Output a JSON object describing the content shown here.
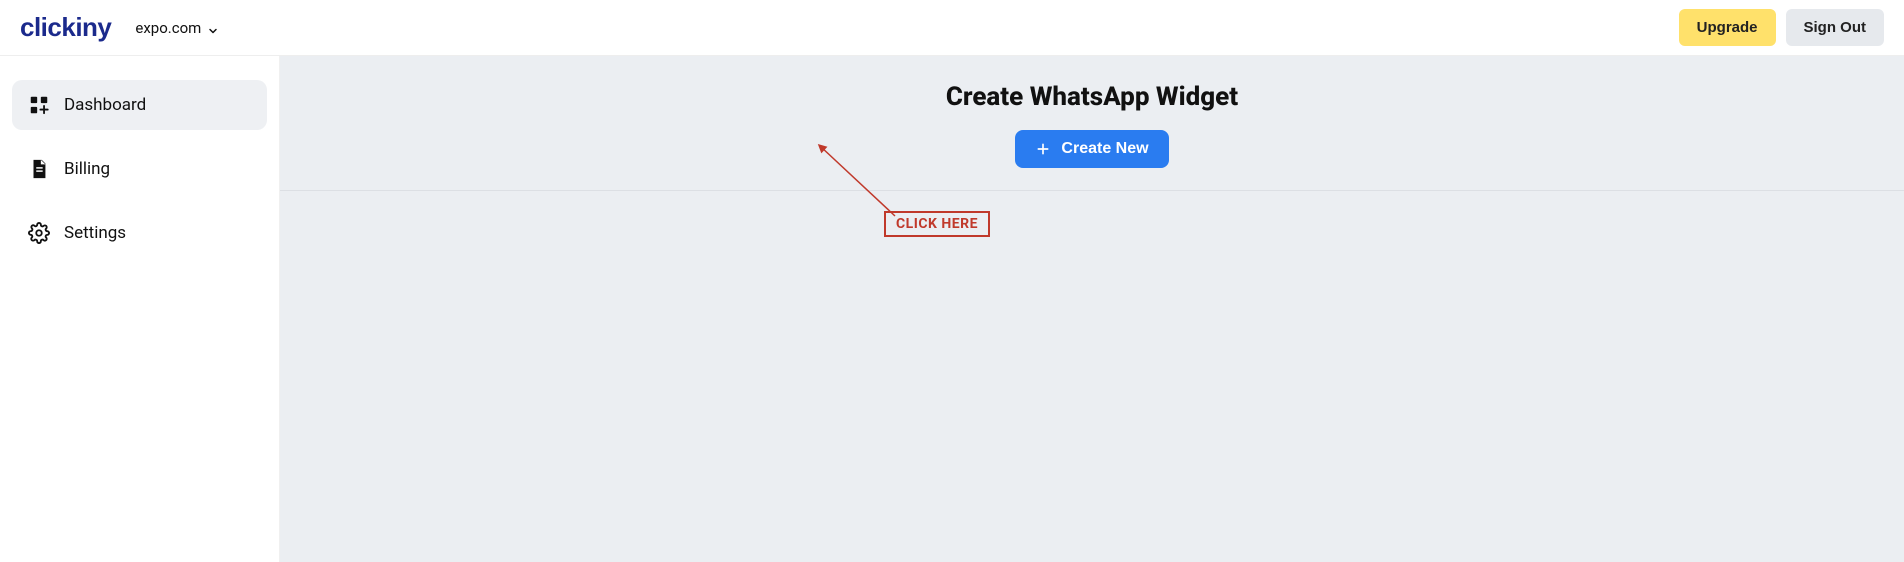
{
  "header": {
    "logo": "clickiny",
    "domain": "expo.com",
    "upgrade_label": "Upgrade",
    "signout_label": "Sign Out"
  },
  "sidebar": {
    "items": [
      {
        "label": "Dashboard",
        "icon": "dashboard-icon",
        "active": true
      },
      {
        "label": "Billing",
        "icon": "file-icon",
        "active": false
      },
      {
        "label": "Settings",
        "icon": "gear-icon",
        "active": false
      }
    ]
  },
  "main": {
    "title": "Create WhatsApp Widget",
    "create_label": "Create New"
  },
  "annotation": {
    "label": "CLICK HERE"
  }
}
